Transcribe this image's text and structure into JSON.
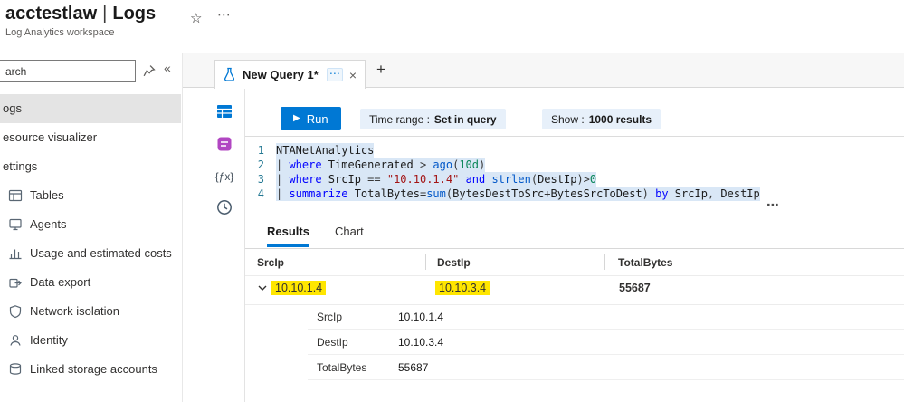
{
  "colors": {
    "accent": "#0078d4",
    "highlight": "#ffe600",
    "selection": "#d9e7f6"
  },
  "glyphs": {
    "star": "☆",
    "header_more": "⋯",
    "collapse": "«",
    "plus": "+",
    "close": "×",
    "tab_more": "⋯",
    "play": "▶",
    "fx": "{ƒx}",
    "editor_more": "⋯"
  },
  "header": {
    "title": "acctestlaw",
    "separator": "|",
    "blade": "Logs",
    "subtitle": "Log Analytics workspace"
  },
  "sidebar": {
    "search_text": "arch",
    "items": [
      {
        "key": "logs",
        "label": "ogs",
        "selected": true,
        "icon": null
      },
      {
        "key": "resource-visualizer",
        "label": "esource visualizer",
        "selected": false,
        "icon": null
      },
      {
        "key": "settings",
        "label": "ettings",
        "selected": false,
        "icon": null
      },
      {
        "key": "tables",
        "label": "Tables",
        "selected": false,
        "icon": "tables"
      },
      {
        "key": "agents",
        "label": "Agents",
        "selected": false,
        "icon": "agents"
      },
      {
        "key": "usage-and-estimated-costs",
        "label": "Usage and estimated costs",
        "selected": false,
        "icon": "usage"
      },
      {
        "key": "data-export",
        "label": "Data export",
        "selected": false,
        "icon": "data-export"
      },
      {
        "key": "network-isolation",
        "label": "Network isolation",
        "selected": false,
        "icon": "network-isolation"
      },
      {
        "key": "identity",
        "label": "Identity",
        "selected": false,
        "icon": "identity"
      },
      {
        "key": "linked-storage-accounts",
        "label": "Linked storage accounts",
        "selected": false,
        "icon": "linked-storage"
      }
    ]
  },
  "tabs": {
    "active_label": "New Query 1*"
  },
  "toolbar": {
    "run_label": "Run",
    "time_range_label": "Time range :",
    "time_range_value": "Set in query",
    "show_label": "Show :",
    "show_value": "1000 results"
  },
  "editor": {
    "lines": [
      {
        "num": 1,
        "tokens": [
          {
            "t": "NTANetAnalytics",
            "c": "id"
          }
        ]
      },
      {
        "num": 2,
        "tokens": [
          {
            "t": "| ",
            "c": "op"
          },
          {
            "t": "where",
            "c": "kw"
          },
          {
            "t": " TimeGenerated ",
            "c": "id"
          },
          {
            "t": "> ",
            "c": "op"
          },
          {
            "t": "ago",
            "c": "fn"
          },
          {
            "t": "(",
            "c": "op"
          },
          {
            "t": "10d",
            "c": "num"
          },
          {
            "t": ")",
            "c": "op"
          }
        ]
      },
      {
        "num": 3,
        "tokens": [
          {
            "t": "| ",
            "c": "op"
          },
          {
            "t": "where",
            "c": "kw"
          },
          {
            "t": " SrcIp ",
            "c": "id"
          },
          {
            "t": "== ",
            "c": "op"
          },
          {
            "t": "\"10.10.1.4\"",
            "c": "str"
          },
          {
            "t": " ",
            "c": "op"
          },
          {
            "t": "and",
            "c": "kw"
          },
          {
            "t": " ",
            "c": "op"
          },
          {
            "t": "strlen",
            "c": "fn"
          },
          {
            "t": "(",
            "c": "op"
          },
          {
            "t": "DestIp",
            "c": "id"
          },
          {
            "t": ")>",
            "c": "op"
          },
          {
            "t": "0",
            "c": "num"
          }
        ]
      },
      {
        "num": 4,
        "tokens": [
          {
            "t": "| ",
            "c": "op"
          },
          {
            "t": "summarize",
            "c": "kw"
          },
          {
            "t": " TotalBytes",
            "c": "id"
          },
          {
            "t": "=",
            "c": "op"
          },
          {
            "t": "sum",
            "c": "fn"
          },
          {
            "t": "(",
            "c": "op"
          },
          {
            "t": "BytesDestToSrc",
            "c": "id"
          },
          {
            "t": "+",
            "c": "op"
          },
          {
            "t": "BytesSrcToDest",
            "c": "id"
          },
          {
            "t": ") ",
            "c": "op"
          },
          {
            "t": "by",
            "c": "kw"
          },
          {
            "t": " SrcIp",
            "c": "id"
          },
          {
            "t": ", ",
            "c": "op"
          },
          {
            "t": "DestIp",
            "c": "id"
          }
        ]
      }
    ]
  },
  "results": {
    "tab_results": "Results",
    "tab_chart": "Chart",
    "columns": [
      "SrcIp",
      "DestIp",
      "TotalBytes"
    ],
    "row": {
      "SrcIp": "10.10.1.4",
      "DestIp": "10.10.3.4",
      "TotalBytes": "55687"
    },
    "details": [
      {
        "label": "SrcIp",
        "value": "10.10.1.4"
      },
      {
        "label": "DestIp",
        "value": "10.10.3.4"
      },
      {
        "label": "TotalBytes",
        "value": "55687"
      }
    ]
  }
}
